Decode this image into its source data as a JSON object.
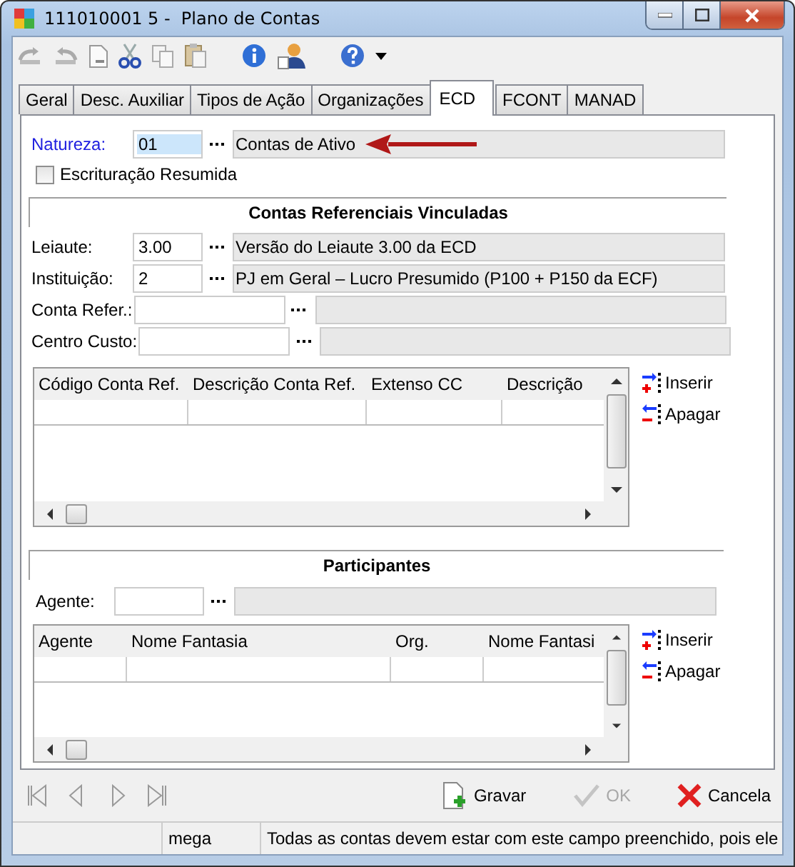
{
  "window": {
    "title": "111010001 5 -  Plano de Contas"
  },
  "tabs": [
    {
      "label": "Geral",
      "selected": false
    },
    {
      "label": "Desc. Auxiliar",
      "selected": false
    },
    {
      "label": "Tipos de Ação",
      "selected": false
    },
    {
      "label": "Organizações",
      "selected": false
    },
    {
      "label": "ECD",
      "selected": true
    },
    {
      "label": "FCONT",
      "selected": false
    },
    {
      "label": "MANAD",
      "selected": false
    }
  ],
  "natureza": {
    "label": "Natureza:",
    "value": "01",
    "description": "Contas de Ativo",
    "focused": true
  },
  "checkbox": {
    "label": "Escrituração Resumida",
    "checked": false
  },
  "referenciais": {
    "title": "Contas Referenciais Vinculadas",
    "fields": [
      {
        "kind": "short",
        "label": "Leiaute:",
        "value": "3.00",
        "description": "Versão do Leiaute 3.00 da ECD"
      },
      {
        "kind": "short",
        "label": "Instituição:",
        "value": "2",
        "description": "PJ em Geral – Lucro Presumido (P100 + P150 da ECF)"
      },
      {
        "kind": "wide",
        "label": "Conta Refer.:"
      },
      {
        "kind": "wide",
        "label": "Centro Custo:"
      }
    ],
    "columns": [
      "Código Conta Ref.",
      "Descrição Conta Ref.",
      "Extenso CC",
      "Descrição"
    ],
    "actions": [
      "Inserir",
      "Apagar"
    ]
  },
  "participantes": {
    "title": "Participantes",
    "agente_label": "Agente:",
    "columns": [
      "Agente",
      "Nome Fantasia",
      "Org.",
      "Nome Fantasi"
    ],
    "actions": [
      "Inserir",
      "Apagar"
    ]
  },
  "buttons": [
    {
      "kind": "save",
      "label": "Gravar",
      "disabled": false
    },
    {
      "kind": "ok",
      "label": "OK",
      "disabled": true
    },
    {
      "kind": "cancel",
      "label": "Cancela",
      "disabled": false
    }
  ],
  "status_bar": [
    "mega",
    "Todas as contas devem estar com este campo preenchido, pois ele"
  ]
}
